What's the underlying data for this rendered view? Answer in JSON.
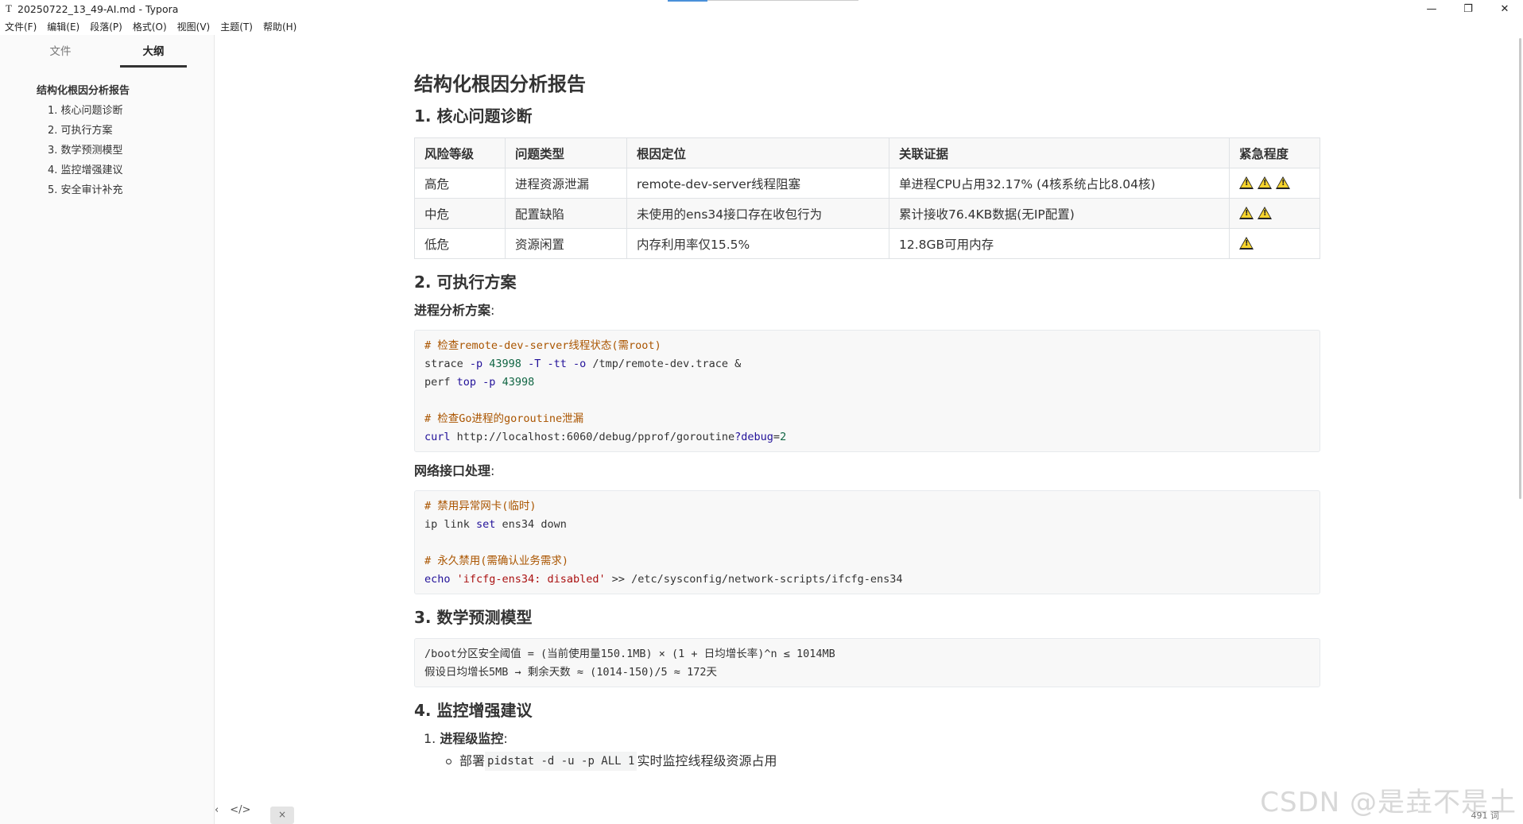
{
  "window": {
    "app_icon": "T",
    "title": "20250722_13_49-AI.md - Typora",
    "min": "—",
    "max": "❐",
    "close": "✕"
  },
  "menu": [
    "文件(F)",
    "编辑(E)",
    "段落(P)",
    "格式(O)",
    "视图(V)",
    "主题(T)",
    "帮助(H)"
  ],
  "sidebar": {
    "tab_files": "文件",
    "tab_outline": "大纲",
    "outline": [
      {
        "label": "结构化根因分析报告",
        "level": 1
      },
      {
        "label": "1. 核心问题诊断",
        "level": 2
      },
      {
        "label": "2. 可执行方案",
        "level": 2
      },
      {
        "label": "3. 数学预测模型",
        "level": 2
      },
      {
        "label": "4. 监控增强建议",
        "level": 2
      },
      {
        "label": "5. 安全审计补充",
        "level": 2
      }
    ],
    "footer_back": "‹",
    "footer_code": "</>",
    "footer_toggle": "×"
  },
  "doc": {
    "title": "结构化根因分析报告",
    "h_diag": "1. 核心问题诊断",
    "table": {
      "headers": [
        "风险等级",
        "问题类型",
        "根因定位",
        "关联证据",
        "紧急程度"
      ],
      "rows": [
        {
          "cells": [
            "高危",
            "进程资源泄漏",
            "remote-dev-server线程阻塞",
            "单进程CPU占用32.17% (4核系统占比8.04核)"
          ],
          "urgency": 3
        },
        {
          "cells": [
            "中危",
            "配置缺陷",
            "未使用的ens34接口存在收包行为",
            "累计接收76.4KB数据(无IP配置)"
          ],
          "urgency": 2
        },
        {
          "cells": [
            "低危",
            "资源闲置",
            "内存利用率仅15.5%",
            "12.8GB可用内存"
          ],
          "urgency": 1
        }
      ]
    },
    "h_plan": "2. 可执行方案",
    "p_proc_label": "进程分析方案",
    "p_net_label": "网络接口处理",
    "colon": ":",
    "code1": {
      "c1": "# 检查remote-dev-server线程状态(需root)",
      "l2a": "strace ",
      "l2b": "-p",
      "l2c": " 43998 ",
      "l2d": "-T -tt -o",
      "l2e": " /tmp/remote-dev.trace &",
      "l3a": "perf ",
      "l3b": "top",
      "l3c": " ",
      "l3d": "-p",
      "l3e": " 43998",
      "c2": "# 检查Go进程的goroutine泄漏",
      "l6a": "curl",
      "l6b": " http://localhost:6060/debug/pprof/goroutine",
      "l6c": "?debug",
      "l6d": "=",
      "l6e": "2"
    },
    "code2": {
      "c1": "# 禁用异常网卡(临时)",
      "l2a": "ip link ",
      "l2b": "set",
      "l2c": " ens34 down",
      "c2": "# 永久禁用(需确认业务需求)",
      "l5a": "echo",
      "l5b": " ",
      "l5c": "'ifcfg-ens34: disabled'",
      "l5d": " >> /etc/sysconfig/network-scripts/ifcfg-ens34"
    },
    "h_math": "3. 数学预测模型",
    "math_line1": "/boot分区安全阈值 = (当前使用量150.1MB) × (1 + 日均增长率)^n ≤ 1014MB",
    "math_line2": "假设日均增长5MB → 剩余天数 ≈ (1014-150)/5 ≈ 172天",
    "h_mon": "4. 监控增强建议",
    "mon_item1_num": "1. ",
    "mon_item1": "进程级监控",
    "mon_bullet1_a": "部署",
    "mon_bullet1_code": "pidstat -d -u -p ALL 1",
    "mon_bullet1_b": "实时监控线程级资源占用"
  },
  "status": {
    "watermark": "CSDN @是垚不是土",
    "word_count": "491 词"
  }
}
